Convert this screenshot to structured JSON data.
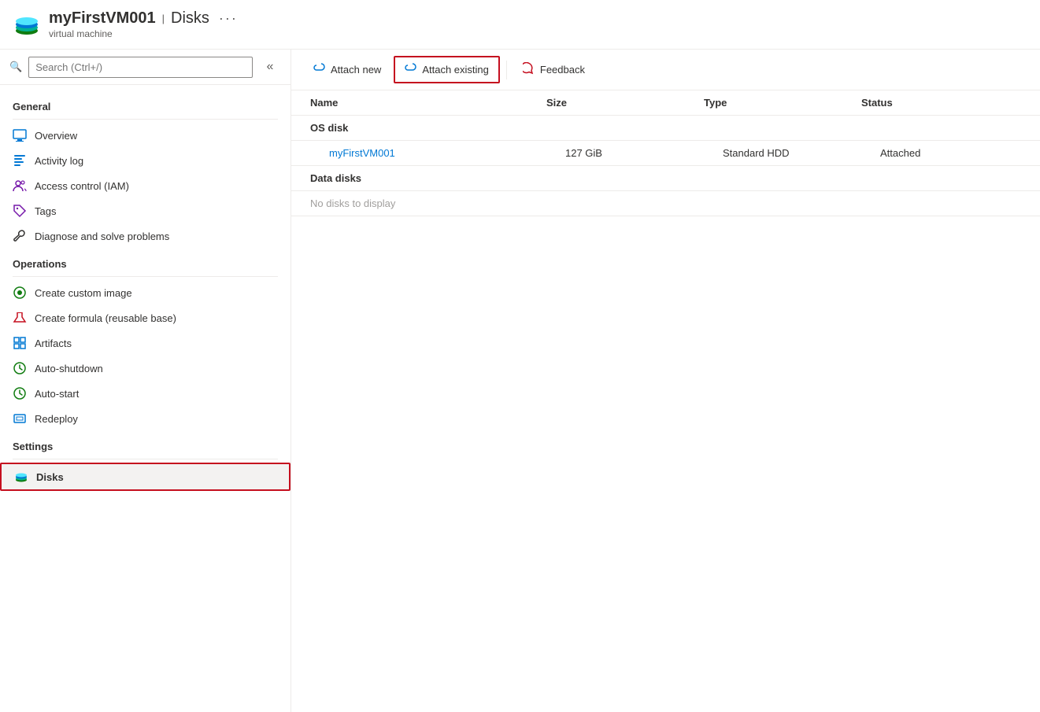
{
  "header": {
    "vm_name": "myFirstVM001",
    "separator": "|",
    "page_title": "Disks",
    "subtitle": "virtual machine",
    "more_options": "···"
  },
  "search": {
    "placeholder": "Search (Ctrl+/)"
  },
  "sidebar": {
    "collapse_icon": "«",
    "sections": [
      {
        "label": "General",
        "items": [
          {
            "id": "overview",
            "label": "Overview",
            "icon": "monitor"
          },
          {
            "id": "activity-log",
            "label": "Activity log",
            "icon": "list"
          },
          {
            "id": "access-control",
            "label": "Access control (IAM)",
            "icon": "people"
          },
          {
            "id": "tags",
            "label": "Tags",
            "icon": "tag"
          },
          {
            "id": "diagnose",
            "label": "Diagnose and solve problems",
            "icon": "wrench"
          }
        ]
      },
      {
        "label": "Operations",
        "items": [
          {
            "id": "create-image",
            "label": "Create custom image",
            "icon": "image"
          },
          {
            "id": "create-formula",
            "label": "Create formula (reusable base)",
            "icon": "beaker"
          },
          {
            "id": "artifacts",
            "label": "Artifacts",
            "icon": "grid"
          },
          {
            "id": "auto-shutdown",
            "label": "Auto-shutdown",
            "icon": "clock"
          },
          {
            "id": "auto-start",
            "label": "Auto-start",
            "icon": "clock"
          },
          {
            "id": "redeploy",
            "label": "Redeploy",
            "icon": "refresh"
          }
        ]
      },
      {
        "label": "Settings",
        "items": [
          {
            "id": "disks",
            "label": "Disks",
            "icon": "disk",
            "active": true
          }
        ]
      }
    ]
  },
  "toolbar": {
    "attach_new_label": "Attach new",
    "attach_existing_label": "Attach existing",
    "feedback_label": "Feedback"
  },
  "table": {
    "columns": [
      "Name",
      "Size",
      "Type",
      "Status"
    ],
    "sections": [
      {
        "label": "OS disk",
        "rows": [
          {
            "name": "myFirstVM001",
            "size": "127 GiB",
            "type": "Standard HDD",
            "status": "Attached"
          }
        ]
      },
      {
        "label": "Data disks",
        "rows": [],
        "empty_message": "No disks to display"
      }
    ]
  }
}
